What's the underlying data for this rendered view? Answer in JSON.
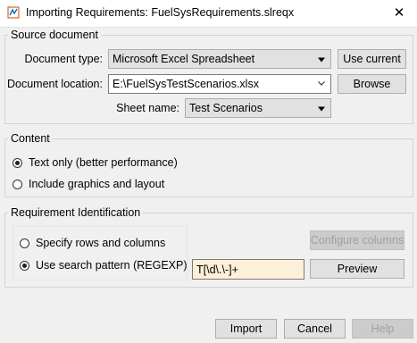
{
  "window": {
    "title": "Importing Requirements: FuelSysRequirements.slreqx",
    "close_label": "✕"
  },
  "source_document": {
    "group_title": "Source document",
    "document_type_label": "Document type:",
    "document_type_value": "Microsoft Excel Spreadsheet",
    "use_current_label": "Use current",
    "document_location_label": "Document location:",
    "document_location_value": "E:\\FuelSysTestScenarios.xlsx",
    "browse_label": "Browse",
    "sheet_name_label": "Sheet name:",
    "sheet_name_value": "Test Scenarios"
  },
  "content": {
    "group_title": "Content",
    "options": [
      {
        "label": "Text only (better performance)",
        "checked": true
      },
      {
        "label": "Include graphics and layout",
        "checked": false
      }
    ]
  },
  "requirement_identification": {
    "group_title": "Requirement Identification",
    "options": [
      {
        "label": "Specify rows and columns",
        "checked": false
      },
      {
        "label": "Use search pattern (REGEXP)",
        "checked": true
      }
    ],
    "configure_columns_label": "Configure columns",
    "pattern_value": "T[\\d\\.\\-]+",
    "preview_label": "Preview"
  },
  "footer": {
    "import_label": "Import",
    "cancel_label": "Cancel",
    "help_label": "Help"
  },
  "icons": {
    "app": "matlab-requirements-icon",
    "dropdown": "dropdown-arrow-icon"
  }
}
